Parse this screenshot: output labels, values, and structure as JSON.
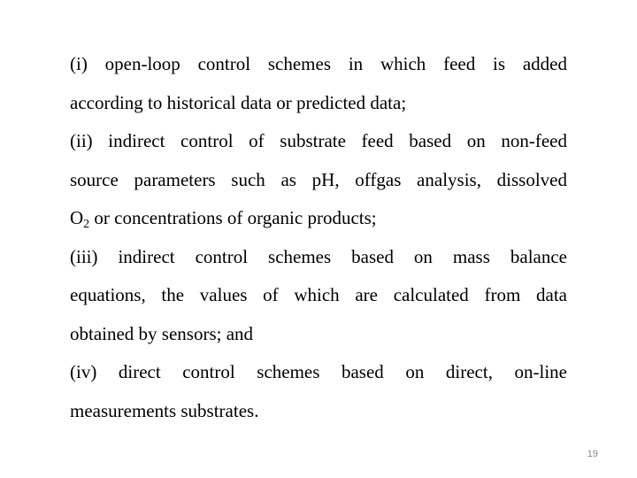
{
  "slide": {
    "items": [
      {
        "label": "(i)",
        "lines": [
          "(i) open-loop control schemes in which feed is added",
          "according to historical data or predicted data;"
        ]
      },
      {
        "label": "(ii)",
        "lines": [
          "(ii) indirect control of substrate feed based on non-feed",
          "source parameters such as pH, offgas analysis, dissolved"
        ],
        "last_line_prefix": "O",
        "last_line_subscript": "2",
        "last_line_rest": " or concentrations of organic products;"
      },
      {
        "label": "(iii)",
        "lines": [
          "(iii) indirect control schemes based on mass balance",
          "equations, the values of which are calculated from data",
          "obtained by sensors; and"
        ]
      },
      {
        "label": "(iv)",
        "lines": [
          "(iv) direct control schemes based on direct, on-line",
          "measurements substrates."
        ]
      }
    ],
    "page_number": "19"
  }
}
